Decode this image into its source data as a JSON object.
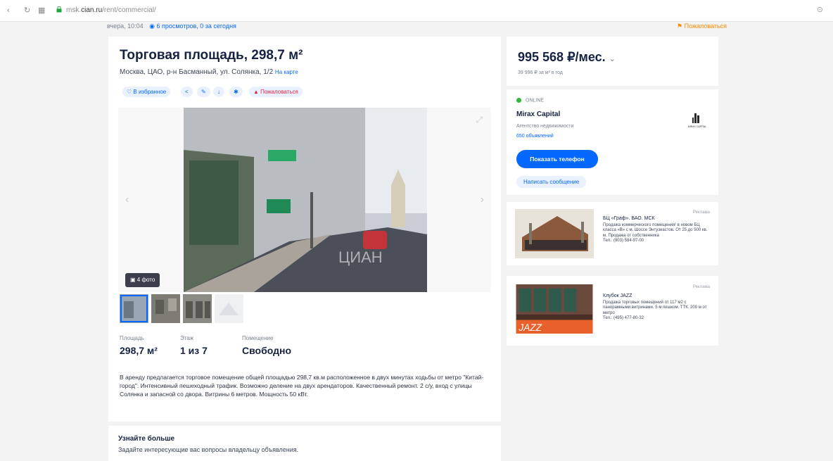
{
  "browser": {
    "url_domain": "cian.ru",
    "url_rest": "/rent/commercial/",
    "url_prefix": "msk."
  },
  "meta": {
    "date": "вчера, 10:04",
    "views": "6 просмотров, 0 за сегодня",
    "complain": "Пожаловаться"
  },
  "listing": {
    "title": "Торговая площадь, 298,7 м²",
    "address": "Москва, ЦАО, р-н Басманный, ул. Солянка, 1/2",
    "map_link": "На карте",
    "actions": [
      "В избранное",
      "Пожаловаться"
    ],
    "photo_count": "4 фото",
    "watermark": "ЦИАН",
    "stats": [
      {
        "label": "Площадь",
        "value": "298,7 м²"
      },
      {
        "label": "Этаж",
        "value": "1 из 7"
      },
      {
        "label": "Помещение",
        "value": "Свободно"
      }
    ],
    "description": "В аренду предлагается торговое помещение общей площадью 298,7 кв.м расположенное в двух минутах ходьбы от метро \"Китай-город\". Интенсивный пешеходный трафик. Возможно деление на двух арендаторов. Качественный ремонт. 2 с/у, вход с улицы Солянка и запасной со двора. Витрины 6 метров. Мощность 50 кВт.",
    "learn_more_title": "Узнайте больше",
    "learn_more_sub": "Задайте интересующие вас вопросы владельцу объявления."
  },
  "price": {
    "value": "995 568 ₽/мес.",
    "per_m2": "39 996 ₽ за м² в год"
  },
  "agent": {
    "status": "ONLINE",
    "name": "Mirax Capital",
    "type": "Агентство недвижимости",
    "ads": "650 объявлений",
    "logo_text": "MIRAX CAPITAL",
    "phone_button": "Показать телефон",
    "message_button": "Написать сообщение"
  },
  "ads": [
    {
      "tag": "Реклама",
      "title": "БЦ «Граф». ВАО. МСК",
      "text": "Продажа коммерческого помещения! в новом БЦ класса «В» с м. Шоссе Энтузиастов. От 25 до 500 кв. м. Продажа от собственника",
      "phone": "Тел.: (903) 584-97-00"
    },
    {
      "tag": "Реклама",
      "title": "Клубок JAZZ",
      "text": "Продажа торговых помещений от 117 м2 с панорамными витринами. 5 м пешком. ТТК. 200 м от метро",
      "phone": "Тел.: (495) 477-80-32",
      "banner_text": "JAZZ"
    }
  ],
  "colors": {
    "accent": "#0468ff",
    "accent_bg": "#eaf1fe",
    "text": "#152242",
    "online": "#31b73b"
  }
}
